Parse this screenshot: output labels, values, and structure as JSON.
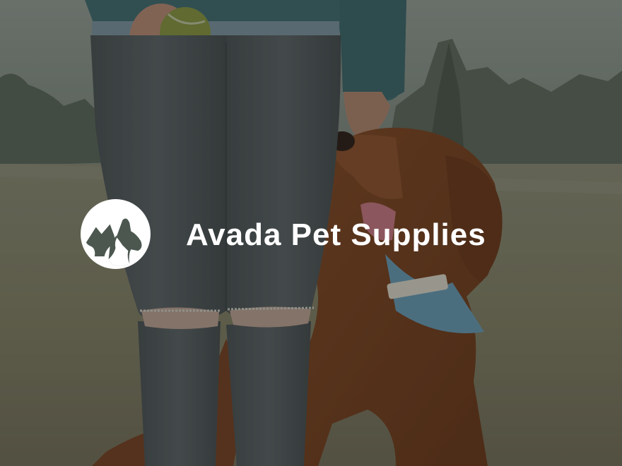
{
  "brand": {
    "name": "Avada Pet Supplies",
    "logo_icon": "cat-and-dog-icon",
    "text_color": "#ffffff"
  },
  "background": {
    "photo": "person-in-ripped-jeans-with-red-setter-dog-holding-tennis-ball-in-field",
    "overlay_color": "#1c211e"
  }
}
